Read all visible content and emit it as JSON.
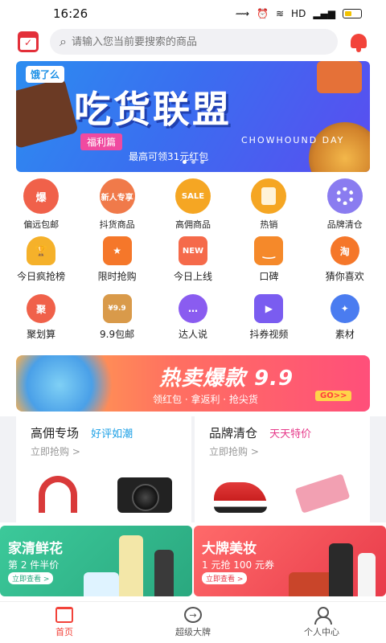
{
  "status_bar": {
    "time": "16:26",
    "icons": [
      "vibrate-icon",
      "alarm-icon",
      "wifi-icon",
      "signal-icon",
      "battery-icon"
    ],
    "network": "HD"
  },
  "search": {
    "placeholder": "请输入您当前要搜索的商品"
  },
  "banner": {
    "logo": "饿了么",
    "title": "吃货联盟",
    "tag": "福利篇",
    "subtitle": "CHOWHOUND DAY",
    "promo": "最高可领31元红包"
  },
  "grid": {
    "row1": [
      {
        "label": "偏远包邮",
        "icon": "burst-icon",
        "text": "爆",
        "color": "#f0614a"
      },
      {
        "label": "抖货商品",
        "icon": "new-user-icon",
        "text": "新人专享",
        "color": "#f07a4a"
      },
      {
        "label": "高佣商品",
        "icon": "sale-tag-icon",
        "text": "SALE",
        "color": "#f5a623"
      },
      {
        "label": "热销",
        "icon": "red-packet-icon",
        "text": "",
        "color": "#f5a623"
      },
      {
        "label": "品牌清仓",
        "icon": "brand-wheel-icon",
        "text": "",
        "color": "#8a7cf0"
      }
    ],
    "row2": [
      {
        "label": "今日疯抢榜",
        "icon": "trophy-icon",
        "text": "",
        "color": "#f5b12a"
      },
      {
        "label": "限时抢购",
        "icon": "star-badge-icon",
        "text": "★",
        "color": "#f5772a"
      },
      {
        "label": "今日上线",
        "icon": "new-badge-icon",
        "text": "NEW",
        "color": "#f56a4a"
      },
      {
        "label": "口碑",
        "icon": "smile-icon",
        "text": "‿",
        "color": "#f5892a"
      },
      {
        "label": "猜你喜欢",
        "icon": "taobao-icon",
        "text": "淘",
        "color": "#f5772a"
      }
    ],
    "row3": [
      {
        "label": "聚划算",
        "icon": "ju-icon",
        "text": "聚",
        "color": "#f0614a"
      },
      {
        "label": "9.9包邮",
        "icon": "box-icon",
        "text": "¥9.9",
        "color": "#d99a4a"
      },
      {
        "label": "达人说",
        "icon": "chat-bubble-icon",
        "text": "…",
        "color": "#8a5cf0"
      },
      {
        "label": "抖券视频",
        "icon": "video-icon",
        "text": "▶",
        "color": "#7a5cf0"
      },
      {
        "label": "素材",
        "icon": "material-icon",
        "text": "",
        "color": "#4a7cf0"
      }
    ]
  },
  "hot_banner": {
    "title": "热卖爆款 9.9",
    "subtitle": "领红包 · 拿返利 · 抢尖货",
    "go": "GO>>"
  },
  "promo_cards": [
    {
      "title": "高佣专场",
      "tag": "好评如潮",
      "tag_color": "#1a9fe6",
      "cta": "立即抢购 >"
    },
    {
      "title": "品牌清仓",
      "tag": "天天特价",
      "tag_color": "#e63a8a",
      "cta": "立即抢购 >"
    }
  ],
  "bottom_cards": [
    {
      "title": "家清鲜花",
      "subtitle": "第 2 件半价",
      "button": "立即查看 >"
    },
    {
      "title": "大牌美妆",
      "subtitle": "1 元抢 100 元券",
      "button": "立即查看 >"
    }
  ],
  "tabbar": [
    {
      "label": "首页",
      "icon": "home-icon",
      "active": true
    },
    {
      "label": "超级大牌",
      "icon": "brand-arrow-icon",
      "active": false
    },
    {
      "label": "个人中心",
      "icon": "user-icon",
      "active": false
    }
  ]
}
